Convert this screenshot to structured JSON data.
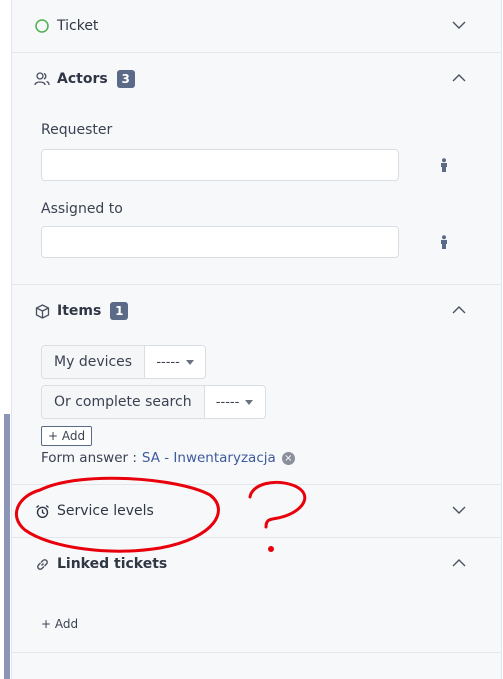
{
  "sections": {
    "ticket": {
      "title": "Ticket"
    },
    "actors": {
      "title": "Actors",
      "count": "3",
      "requester_label": "Requester",
      "requester_value": "",
      "assigned_label": "Assigned to",
      "assigned_value": ""
    },
    "items": {
      "title": "Items",
      "count": "1",
      "my_devices_label": "My devices",
      "my_devices_value": "-----",
      "search_label": "Or complete search",
      "search_value": "-----",
      "add_label": "+ Add",
      "form_answer_label": "Form answer :",
      "form_answer_link": "SA - Inwentaryzacja"
    },
    "service_levels": {
      "title": "Service levels"
    },
    "linked_tickets": {
      "title": "Linked tickets",
      "add_label": "+ Add"
    }
  },
  "annotation": {
    "text": "?"
  },
  "colors": {
    "panel_bg": "#f7f8fa",
    "badge_bg": "#5b6a86",
    "link": "#3d5a9e",
    "ticket_status_ring": "#4caf50",
    "annotation_red": "#e8000b"
  }
}
